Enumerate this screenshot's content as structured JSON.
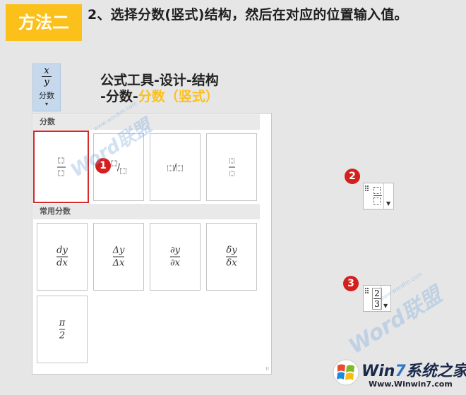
{
  "header": {
    "method_tag": "方法二",
    "headline": "2、选择分数(竖式)结构，然后在对应的位置输入值。"
  },
  "ribbon_button": {
    "symbol_num": "x",
    "symbol_den": "y",
    "label": "分数",
    "caret": "▾"
  },
  "path": {
    "line1": "公式工具-设计-结构",
    "line2_prefix": "-分数-",
    "line2_highlight": "分数（竖式）"
  },
  "gallery": {
    "section1": "分数",
    "section2": "常用分数",
    "common": [
      {
        "num": "dy",
        "den": "dx"
      },
      {
        "num": "Δy",
        "den": "Δx"
      },
      {
        "num": "∂y",
        "den": "∂x"
      },
      {
        "num": "δy",
        "den": "δx"
      },
      {
        "num": "π",
        "den": "2"
      }
    ],
    "slash": "/"
  },
  "badges": [
    "1",
    "2",
    "3"
  ],
  "filled_control": {
    "num": "2",
    "den": "3"
  },
  "watermark": {
    "text": "Word联盟",
    "url": "www.wordlm.com"
  },
  "brand": {
    "name_a": "Win",
    "name_b": "7",
    "name_c": "系统之家",
    "url": "Www.Winwin7.com"
  },
  "colors": {
    "accent": "#fcc01b",
    "badge": "#d41f1f",
    "selection": "#d42a2a",
    "ribbon": "#c5d8ec"
  }
}
